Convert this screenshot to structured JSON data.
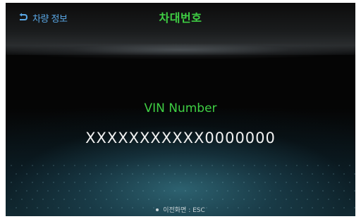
{
  "header": {
    "back_label": "차량 정보",
    "back_icon": "back-arrow-icon",
    "title": "차대번호"
  },
  "main": {
    "vin_label": "VIN Number",
    "vin_value": "XXXXXXXXXXX0000000"
  },
  "footer": {
    "hint": "이전화면 : ESC"
  },
  "colors": {
    "accent_green": "#3fcf44",
    "back_blue": "#5aa8e6",
    "background": "#050505",
    "value_text": "#f2f2f2"
  }
}
